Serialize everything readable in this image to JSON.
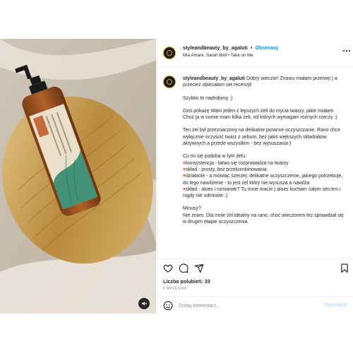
{
  "header": {
    "username": "styleandbeauty_by_agaluti",
    "separator": "•",
    "follow_label": "Obserwuj",
    "music": "Mia Amare, Sarah Bird • Take on Me"
  },
  "caption": {
    "username": "styleandbeauty_by_agaluti",
    "intro": "Dobry wieczor! Znowu miałam przerwę:) a przecież obiecałam set recenzji!",
    "p1": "Szybko to nadrobimy :)",
    "p2": "Dziś pokażę Wam jeden z lepszych żeli do mycia twarzy, jakie miałam. Choć ja w sumie mam kilka żeli, od których wymagam różnych rzeczy :)",
    "p3": "Ten żel był przeznaczony na delikatne poranne oczyszczanie. Rano chce wyłącznie oczyścić twarz z sebum, bez jakiś większych składników aktywnych a przede wszystkim - bez wysuszania:)",
    "p4_intro": "Co mi się podoba w tym żelu:",
    "bullets": [
      "konsystencja - łatwo się rozprowadza na twarzy",
      "skład - prosty, bez przekombinowania",
      "działanie - a mówiąc szerzej: delikatne oczyszczenie, jakiego potrzebuje, do tego nawilżenie - to jest żel który nie wysusza a nawilża",
      "skład - aloes i rumianek? Tu mnie macie:) aloes kocham całym sercem i nigdy nie odmowie ;)"
    ],
    "p5a": "Minusy?",
    "p5b": "Nie znam. Dla mnie żel idealny na rano, choć wieczorem tez sprawdzał się w drugim etapie oczyszczenia."
  },
  "engagement": {
    "likes": "Liczba polubień: 33",
    "date": "8 WRZEŚNIA"
  },
  "comment": {
    "placeholder": "Dodaj komentarz...",
    "publish_label": "Opublikuj"
  },
  "product": {
    "brand": "NATURE OF EARTH",
    "name": "ŁAGODZĄCY ŻEL DO MYCIA TWARZY",
    "sub": "SOOTHING FACIAL WASH GEL"
  },
  "colors": {
    "accent": "#0095f6",
    "heart": "#e0572a",
    "muted": "#8e8e8e"
  },
  "icons": [
    "more-options-icon",
    "heart-icon",
    "comment-icon",
    "share-icon",
    "bookmark-icon",
    "emoji-icon",
    "mute-icon"
  ]
}
